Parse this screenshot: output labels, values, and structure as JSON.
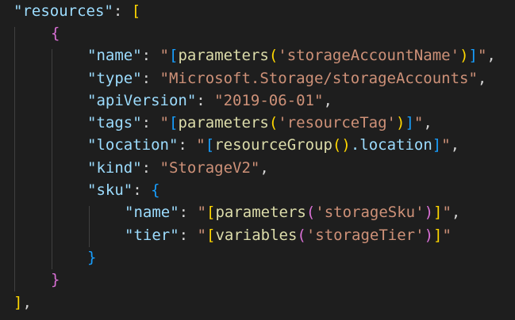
{
  "code": {
    "language": "json",
    "lines": [
      {
        "key": "\"resources\"",
        "after": ": ",
        "open": "["
      },
      {
        "open": "{"
      },
      {
        "key": "\"name\"",
        "after": ": ",
        "q1": "\"",
        "b1": "[",
        "fn": "parameters",
        "p1": "(",
        "arg": "'storageAccountName'",
        "p2": ")",
        "b2": "]",
        "q2": "\"",
        "tail": ","
      },
      {
        "key": "\"type\"",
        "after": ": ",
        "str": "\"Microsoft.Storage/storageAccounts\"",
        "tail": ","
      },
      {
        "key": "\"apiVersion\"",
        "after": ": ",
        "str": "\"2019-06-01\"",
        "tail": ","
      },
      {
        "key": "\"tags\"",
        "after": ": ",
        "q1": "\"",
        "b1": "[",
        "fn": "parameters",
        "p1": "(",
        "arg": "'resourceTag'",
        "p2": ")",
        "b2": "]",
        "q2": "\"",
        "tail": ","
      },
      {
        "key": "\"location\"",
        "after": ": ",
        "q1": "\"",
        "b1": "[",
        "fn": "resourceGroup",
        "p1": "(",
        "p2": ")",
        "member": ".location",
        "b2": "]",
        "q2": "\"",
        "tail": ","
      },
      {
        "key": "\"kind\"",
        "after": ": ",
        "str": "\"StorageV2\"",
        "tail": ","
      },
      {
        "key": "\"sku\"",
        "after": ": ",
        "open": "{"
      },
      {
        "key": "\"name\"",
        "after": ": ",
        "q1": "\"",
        "b1": "[",
        "fn": "parameters",
        "p1": "(",
        "arg": "'storageSku'",
        "p2": ")",
        "b2": "]",
        "q2": "\"",
        "tail": ","
      },
      {
        "key": "\"tier\"",
        "after": ": ",
        "q1": "\"",
        "b1": "[",
        "fn": "variables",
        "p1": "(",
        "arg": "'storageTier'",
        "p2": ")",
        "b2": "]",
        "q2": "\""
      },
      {
        "close": "}"
      },
      {
        "close": "}"
      },
      {
        "close": "]",
        "tail": ","
      }
    ]
  },
  "colors": {
    "background": "#1e1e1e",
    "key": "#9cdcfe",
    "string": "#ce9178",
    "function": "#dcdcaa",
    "bracket_level1": "#ffd700",
    "bracket_level2": "#da70d6",
    "bracket_level3": "#179fff",
    "punctuation": "#d4d4d4"
  }
}
